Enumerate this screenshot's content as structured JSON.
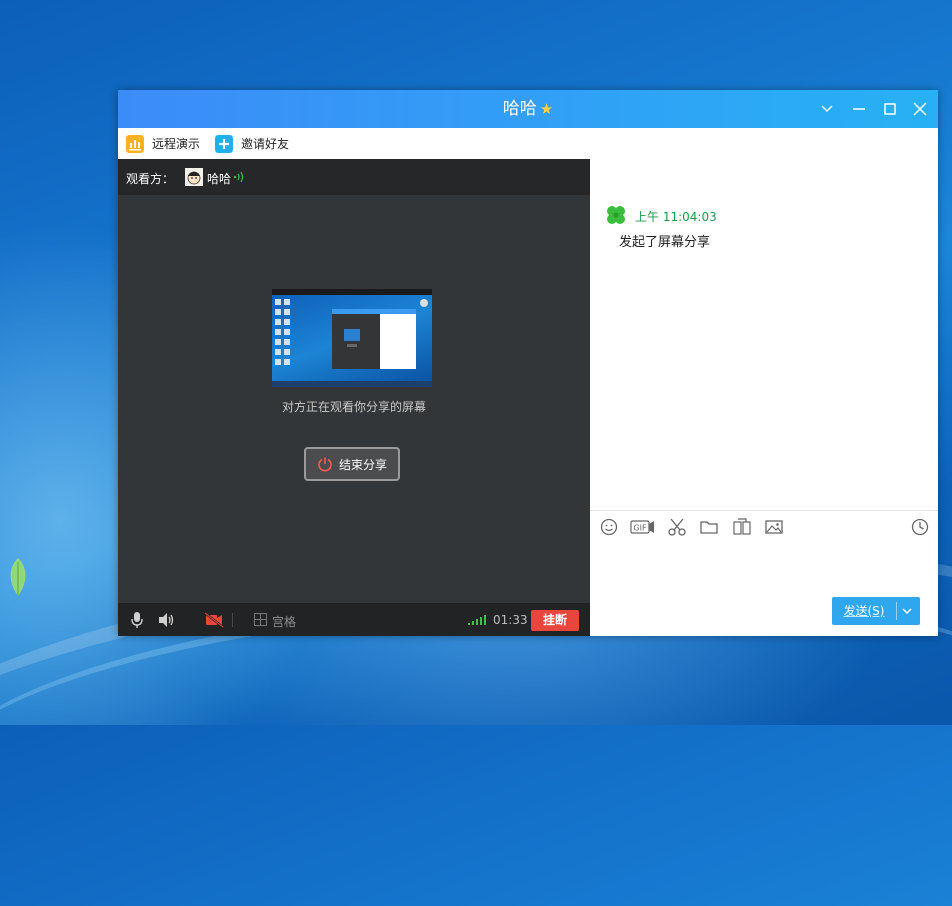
{
  "window": {
    "title": "哈哈",
    "title_badge": "★"
  },
  "toolbar": {
    "remote_demo": "远程演示",
    "invite_friends": "邀请好友"
  },
  "viewer": {
    "label": "观看方：",
    "name": "哈哈"
  },
  "stage": {
    "caption": "对方正在观看你分享的屏幕",
    "end_share": "结束分享"
  },
  "bottombar": {
    "grid_label": "宫格",
    "timer": "01:33",
    "hangup": "挂断"
  },
  "chat": {
    "timestamp": "上午 11:04:03",
    "message": "发起了屏幕分享"
  },
  "compose": {
    "send_label": "发送(S)"
  },
  "colors": {
    "title_start": "#3c8cf8",
    "title_end": "#27b1f4",
    "hangup": "#e8453c",
    "send": "#2ea7ef",
    "timestamp": "#1e9a4a"
  }
}
